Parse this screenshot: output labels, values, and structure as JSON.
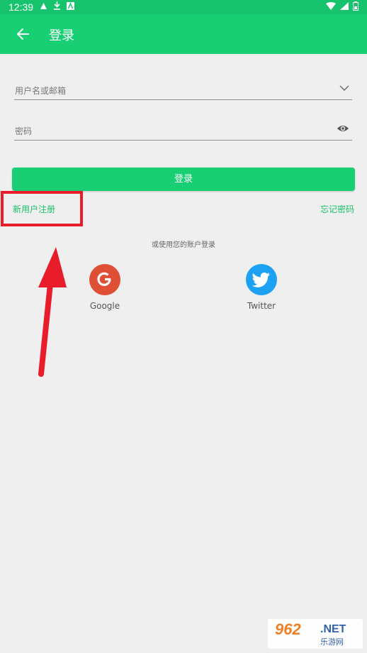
{
  "status_bar": {
    "time": "12:39"
  },
  "toolbar": {
    "title": "登录"
  },
  "form": {
    "username_placeholder": "用户名或邮箱",
    "password_placeholder": "密码",
    "login_label": "登录"
  },
  "links": {
    "register": "新用户注册",
    "forgot": "忘记密码"
  },
  "social": {
    "heading": "或使用您的账户登录",
    "google_label": "Google",
    "twitter_label": "Twitter"
  },
  "watermark": {
    "brand": "962",
    "domain": ".NET",
    "site": "乐游网"
  },
  "colors": {
    "primary": "#19cf73",
    "status_bar": "#17c36d",
    "link": "#19c06a",
    "google": "#de4f35",
    "twitter": "#1da1f2",
    "annotation": "#e81c2a"
  },
  "icons": {
    "back": "arrow-left-icon",
    "dropdown": "chevron-down-icon",
    "visibility": "eye-icon",
    "google": "google-g-icon",
    "twitter": "twitter-bird-icon"
  }
}
